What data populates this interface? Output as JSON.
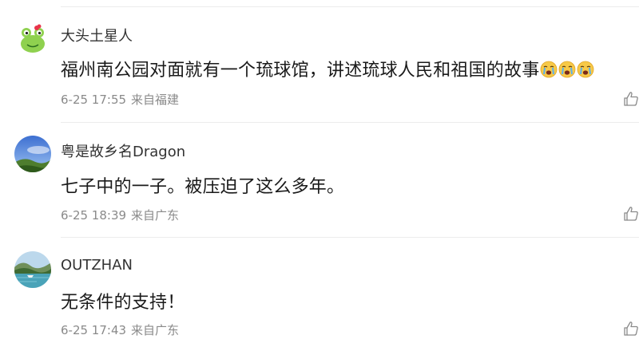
{
  "comments": [
    {
      "username": "大头土星人",
      "content": "福州南公园对面就有一个琉球馆，讲述琉球人民和祖国的故事",
      "emojis": [
        "crying-face-icon",
        "crying-face-icon",
        "crying-face-icon"
      ],
      "time": "6-25 17:55",
      "source": "来自福建"
    },
    {
      "username": "粤是故乡名Dragon",
      "content": "七子中的一子。被压迫了这么多年。",
      "time": "6-25 18:39",
      "source": "来自广东"
    },
    {
      "username": "OUTZHAN",
      "content": "无条件的支持！",
      "time": "6-25 17:43",
      "source": "来自广东"
    }
  ],
  "colors": {
    "text_primary": "#1a1a1a",
    "text_secondary": "#8a8a8a",
    "divider": "#ececec"
  }
}
